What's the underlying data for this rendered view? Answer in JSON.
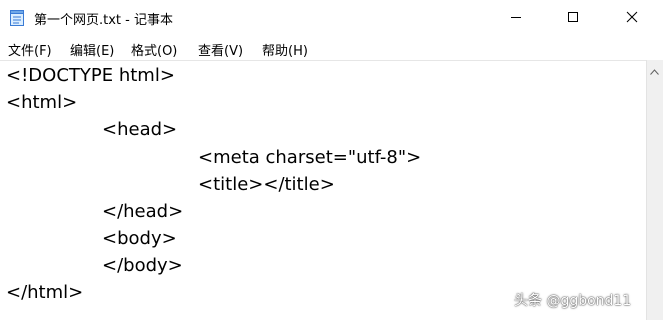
{
  "window": {
    "title": "第一个网页.txt - 记事本",
    "app_icon": "notepad-icon",
    "controls": {
      "minimize_icon": "minimize-icon",
      "maximize_icon": "maximize-icon",
      "close_icon": "close-icon"
    }
  },
  "menubar": {
    "items": [
      {
        "label": "文件(F)"
      },
      {
        "label": "编辑(E)"
      },
      {
        "label": "格式(O)"
      },
      {
        "label": "查看(V)"
      },
      {
        "label": "帮助(H)"
      }
    ]
  },
  "editor": {
    "lines": [
      "<!DOCTYPE html>",
      "<html>",
      "<head>",
      "<meta charset=\"utf-8\">",
      "<title></title>",
      "</head>",
      "<body>",
      "</body>",
      "</html>"
    ]
  },
  "watermark": {
    "text": "头条 @ggbond11"
  },
  "colors": {
    "background": "#ffffff",
    "text": "#000000",
    "scrollbar": "#f0f0f0"
  }
}
